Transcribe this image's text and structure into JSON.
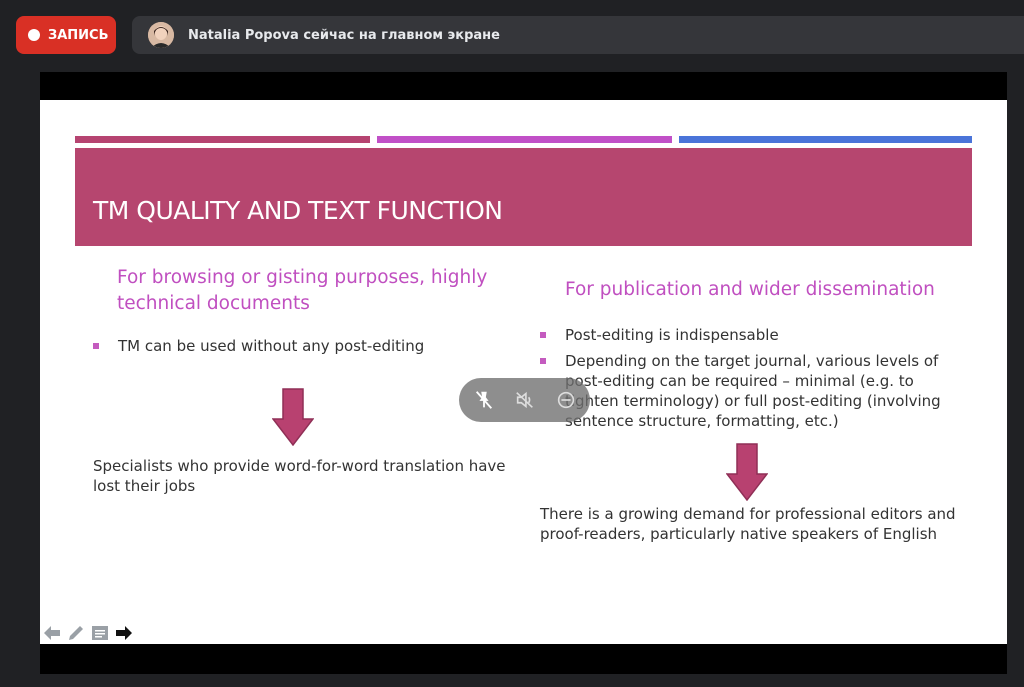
{
  "meet": {
    "record_label": "ЗАПИСЬ",
    "presenter_status": "Natalia Popova сейчас на главном экране",
    "accent_red": "#d93025"
  },
  "slide": {
    "title": "TM QUALITY AND TEXT FUNCTION",
    "left": {
      "heading": "For browsing or gisting purposes, highly technical documents",
      "bullets": [
        "TM can be used without any post-editing"
      ],
      "conclusion": "Specialists who provide word-for-word translation have lost their jobs"
    },
    "right": {
      "heading": "For publication and wider dissemination",
      "bullets": [
        "Post-editing is indispensable",
        "Depending on the target journal, various levels of post-editing can be required – minimal (e.g. to tighten terminology) or full post-editing (involving sentence structure, formatting, etc.)"
      ],
      "conclusion": "There is a growing demand for professional editors and proof-readers, particularly native speakers of English"
    },
    "colors": {
      "title_band": "#b6466f",
      "stripe_1": "#b64471",
      "stripe_2": "#c150c7",
      "stripe_3": "#4a74d9",
      "heading": "#c04fc0",
      "arrow": "#b84170"
    }
  },
  "media_controls": {
    "icons": [
      "unpin-icon",
      "mute-icon",
      "remove-icon"
    ]
  },
  "slide_tools": {
    "icons": [
      "arrow-left-icon",
      "pen-icon",
      "slide-menu-icon",
      "arrow-right-icon"
    ]
  }
}
